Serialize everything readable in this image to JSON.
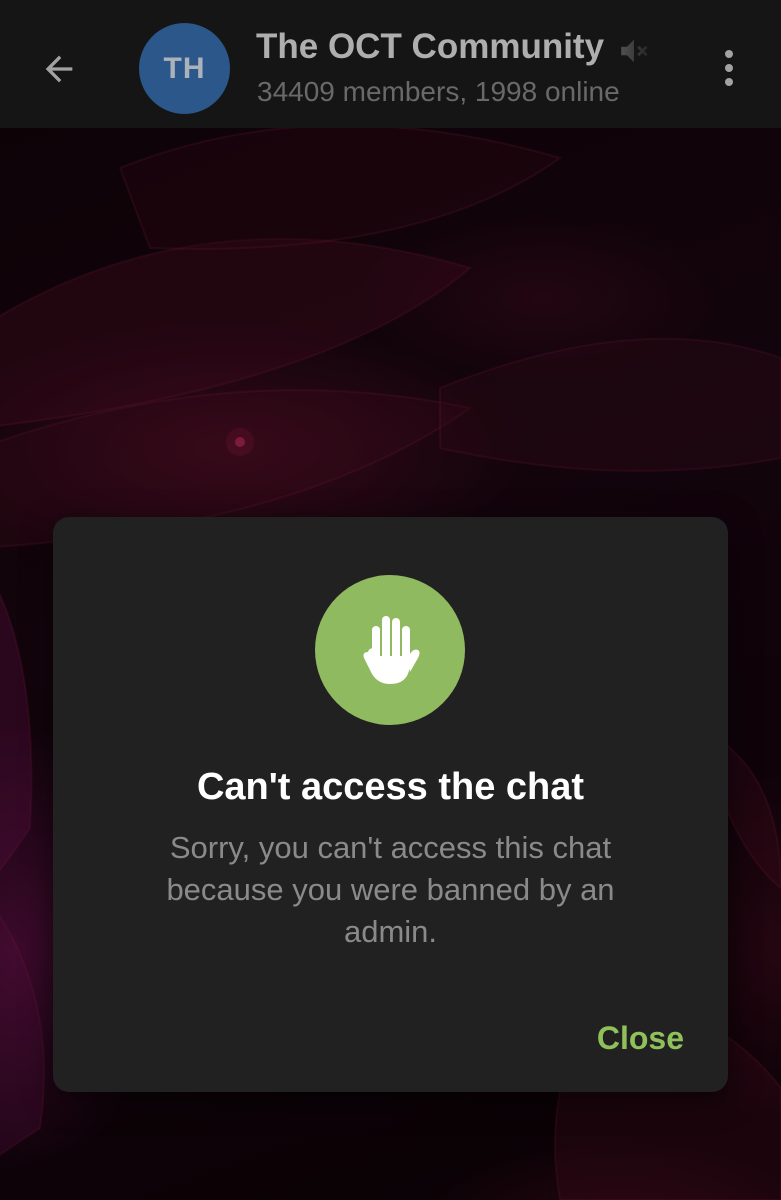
{
  "header": {
    "back_icon": "arrow-left-icon",
    "avatar_initials": "TH",
    "avatar_color": "#3a74b8",
    "title": "The OCT Community",
    "mute_icon": "speaker-muted-icon",
    "subtitle": "34409 members, 1998 online",
    "menu_icon": "more-vertical-icon"
  },
  "dialog": {
    "icon": "raised-hand-icon",
    "icon_bg_color": "#8fba5f",
    "title": "Can't access the chat",
    "message": "Sorry, you can't access this chat because you were banned by an admin.",
    "close_label": "Close",
    "accent_color": "#8fc15b"
  },
  "colors": {
    "header_bg": "#1c1c1d",
    "dialog_bg": "#212121"
  }
}
